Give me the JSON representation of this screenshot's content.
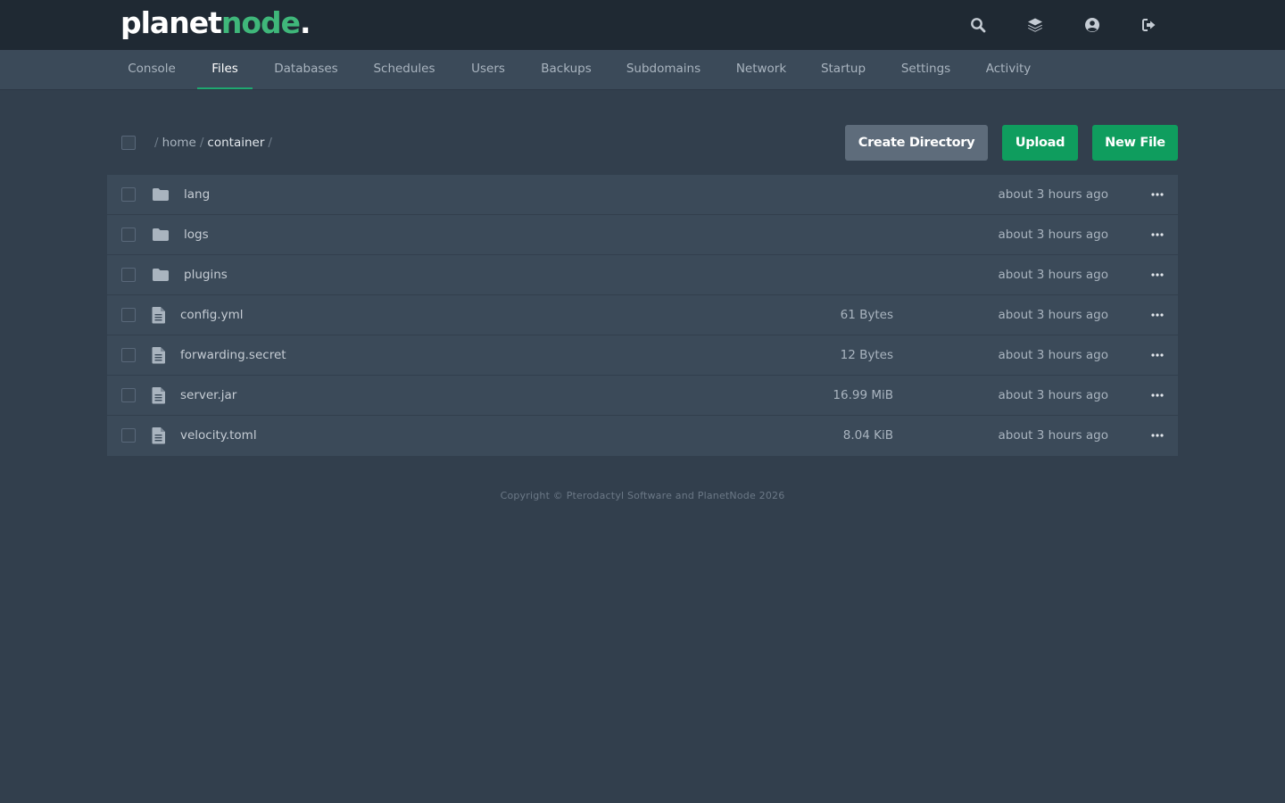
{
  "brand": {
    "logo_main": "planet",
    "logo_accent": "node",
    "logo_dot": ".",
    "accent_color": "#3fb77a"
  },
  "topbar": {
    "icons": [
      "search-icon",
      "layers-icon",
      "account-icon",
      "sign-out-icon"
    ]
  },
  "nav": {
    "tabs": [
      {
        "label": "Console"
      },
      {
        "label": "Files",
        "active": true
      },
      {
        "label": "Databases"
      },
      {
        "label": "Schedules"
      },
      {
        "label": "Users"
      },
      {
        "label": "Backups"
      },
      {
        "label": "Subdomains"
      },
      {
        "label": "Network"
      },
      {
        "label": "Startup"
      },
      {
        "label": "Settings"
      },
      {
        "label": "Activity"
      }
    ],
    "active_color": "#1fa870"
  },
  "breadcrumb": {
    "sep": "/",
    "items": [
      "home",
      "container"
    ]
  },
  "actions": {
    "create_directory": "Create Directory",
    "upload": "Upload",
    "new_file": "New File"
  },
  "files": [
    {
      "name": "lang",
      "type": "folder",
      "size": "",
      "modified": "about 3 hours ago"
    },
    {
      "name": "logs",
      "type": "folder",
      "size": "",
      "modified": "about 3 hours ago"
    },
    {
      "name": "plugins",
      "type": "folder",
      "size": "",
      "modified": "about 3 hours ago"
    },
    {
      "name": "config.yml",
      "type": "file",
      "size": "61 Bytes",
      "modified": "about 3 hours ago"
    },
    {
      "name": "forwarding.secret",
      "type": "file",
      "size": "12 Bytes",
      "modified": "about 3 hours ago"
    },
    {
      "name": "server.jar",
      "type": "file",
      "size": "16.99 MiB",
      "modified": "about 3 hours ago"
    },
    {
      "name": "velocity.toml",
      "type": "file",
      "size": "8.04 KiB",
      "modified": "about 3 hours ago"
    }
  ],
  "footer": {
    "text": "Copyright © Pterodactyl Software and PlanetNode 2026"
  }
}
